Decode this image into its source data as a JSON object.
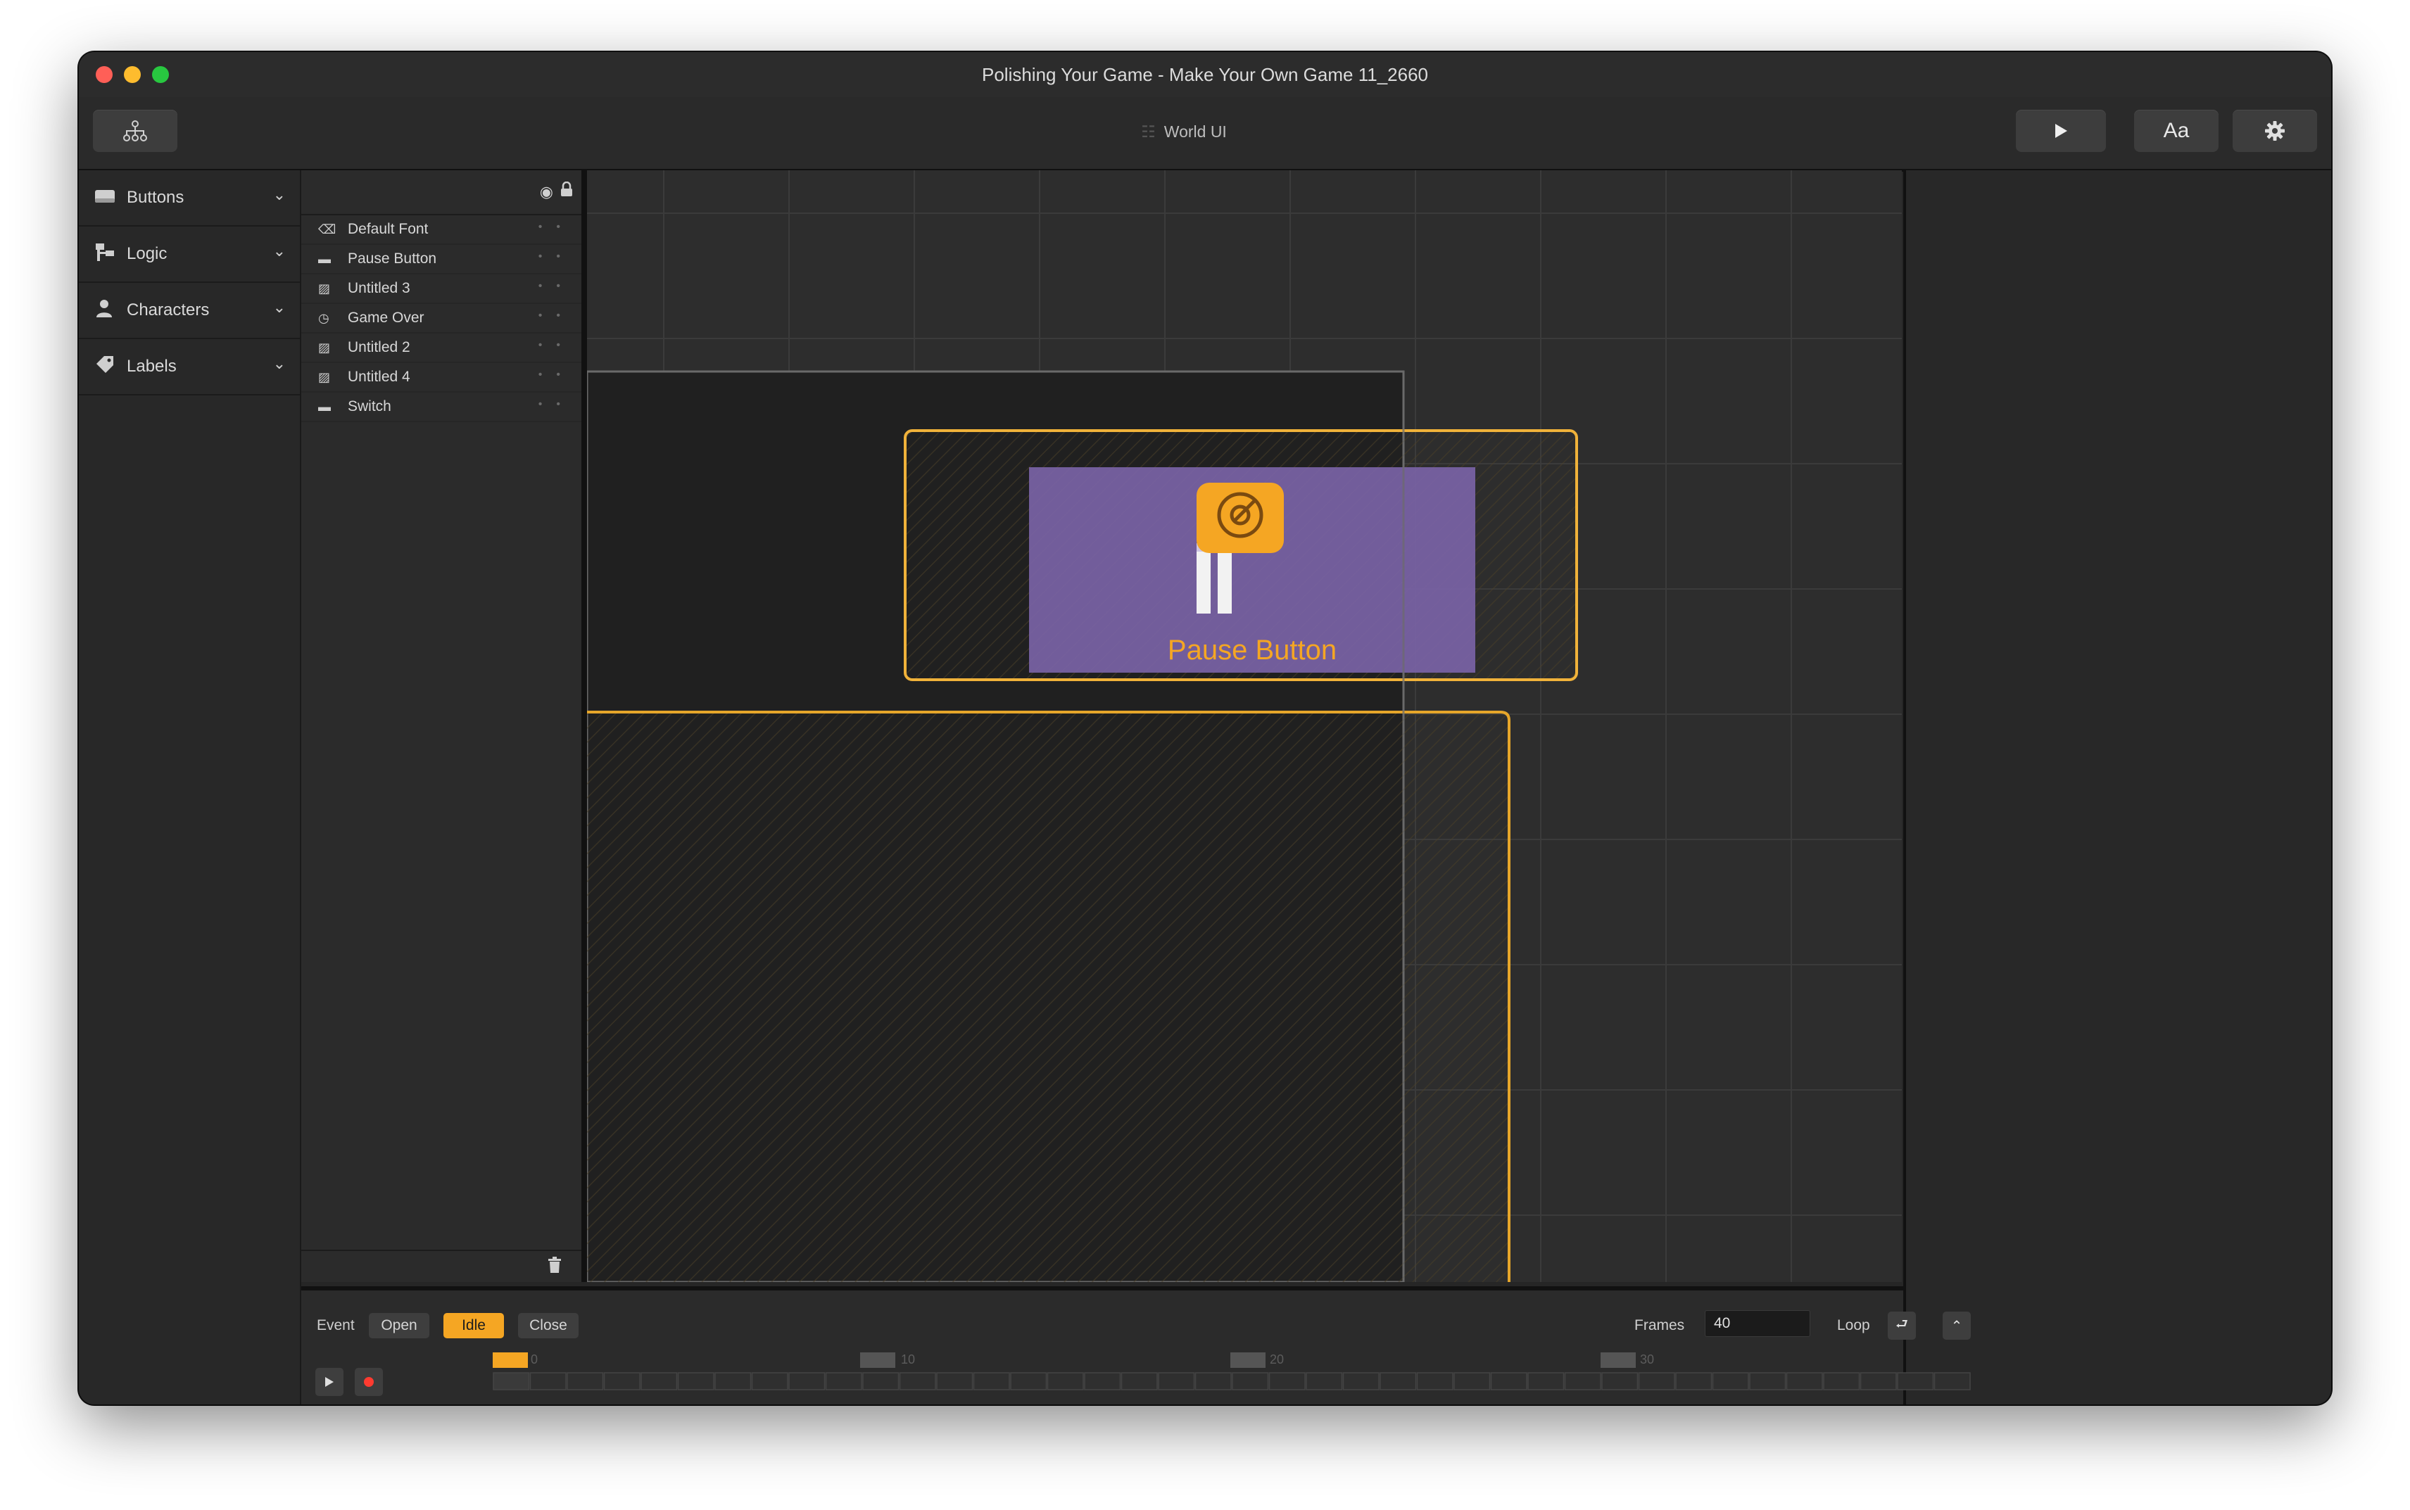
{
  "window": {
    "title": "Polishing Your Game - Make Your Own Game 11_2660"
  },
  "toolbar": {
    "center_title": "World UI",
    "font_button_label": "Aa"
  },
  "sidebar": {
    "categories": [
      {
        "label": "Buttons",
        "icon": "button-icon"
      },
      {
        "label": "Logic",
        "icon": "logic-icon"
      },
      {
        "label": "Characters",
        "icon": "person-icon"
      },
      {
        "label": "Labels",
        "icon": "tag-icon"
      }
    ]
  },
  "layers": {
    "items": [
      {
        "label": "Default Font",
        "icon": "font-icon"
      },
      {
        "label": "Pause Button",
        "icon": "button-icon"
      },
      {
        "label": "Untitled 3",
        "icon": "image-icon"
      },
      {
        "label": "Game Over",
        "icon": "timer-icon"
      },
      {
        "label": "Untitled 2",
        "icon": "image-icon"
      },
      {
        "label": "Untitled 4",
        "icon": "image-icon"
      },
      {
        "label": "Switch",
        "icon": "button-icon"
      }
    ]
  },
  "canvas": {
    "selected_button_label": "Pause Button",
    "colors": {
      "accent": "#f5a623",
      "button_fill": "#7a63a6",
      "dark_area": "#202020"
    }
  },
  "timeline": {
    "event_label": "Event",
    "events": [
      {
        "label": "Open",
        "active": false
      },
      {
        "label": "Idle",
        "active": true
      },
      {
        "label": "Close",
        "active": false
      }
    ],
    "frames_label": "Frames",
    "frames_value": "40",
    "loop_label": "Loop",
    "frame_ticks": [
      "0",
      "10",
      "20",
      "30"
    ],
    "frame_count": 40,
    "current_frame": 0
  }
}
